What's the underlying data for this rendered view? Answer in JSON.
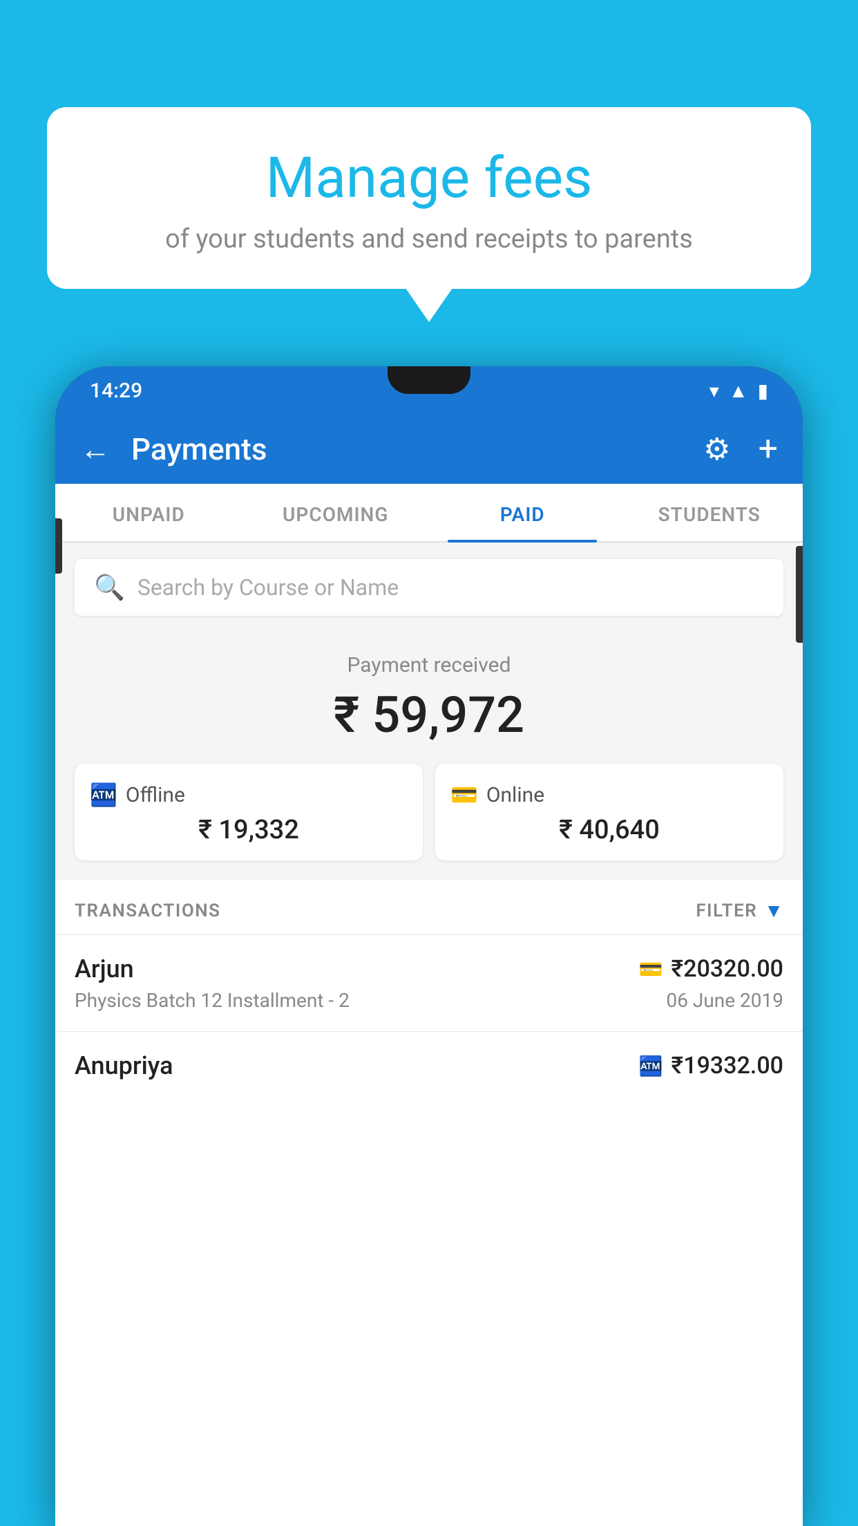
{
  "background_color": "#1BB8E8",
  "speech_bubble": {
    "title": "Manage fees",
    "subtitle": "of your students and send receipts to parents"
  },
  "status_bar": {
    "time": "14:29",
    "icons": [
      "wifi",
      "signal",
      "battery"
    ]
  },
  "header": {
    "title": "Payments",
    "back_label": "←",
    "gear_label": "⚙",
    "plus_label": "+"
  },
  "tabs": [
    {
      "label": "UNPAID",
      "active": false
    },
    {
      "label": "UPCOMING",
      "active": false
    },
    {
      "label": "PAID",
      "active": true
    },
    {
      "label": "STUDENTS",
      "active": false
    }
  ],
  "search": {
    "placeholder": "Search by Course or Name"
  },
  "payment_summary": {
    "label": "Payment received",
    "amount": "₹ 59,972",
    "offline": {
      "label": "Offline",
      "amount": "₹ 19,332"
    },
    "online": {
      "label": "Online",
      "amount": "₹ 40,640"
    }
  },
  "transactions_section": {
    "label": "TRANSACTIONS",
    "filter_label": "FILTER"
  },
  "transactions": [
    {
      "name": "Arjun",
      "course": "Physics Batch 12 Installment - 2",
      "amount": "₹20320.00",
      "date": "06 June 2019",
      "payment_type": "card"
    },
    {
      "name": "Anupriya",
      "course": "",
      "amount": "₹19332.00",
      "date": "",
      "payment_type": "cash"
    }
  ]
}
